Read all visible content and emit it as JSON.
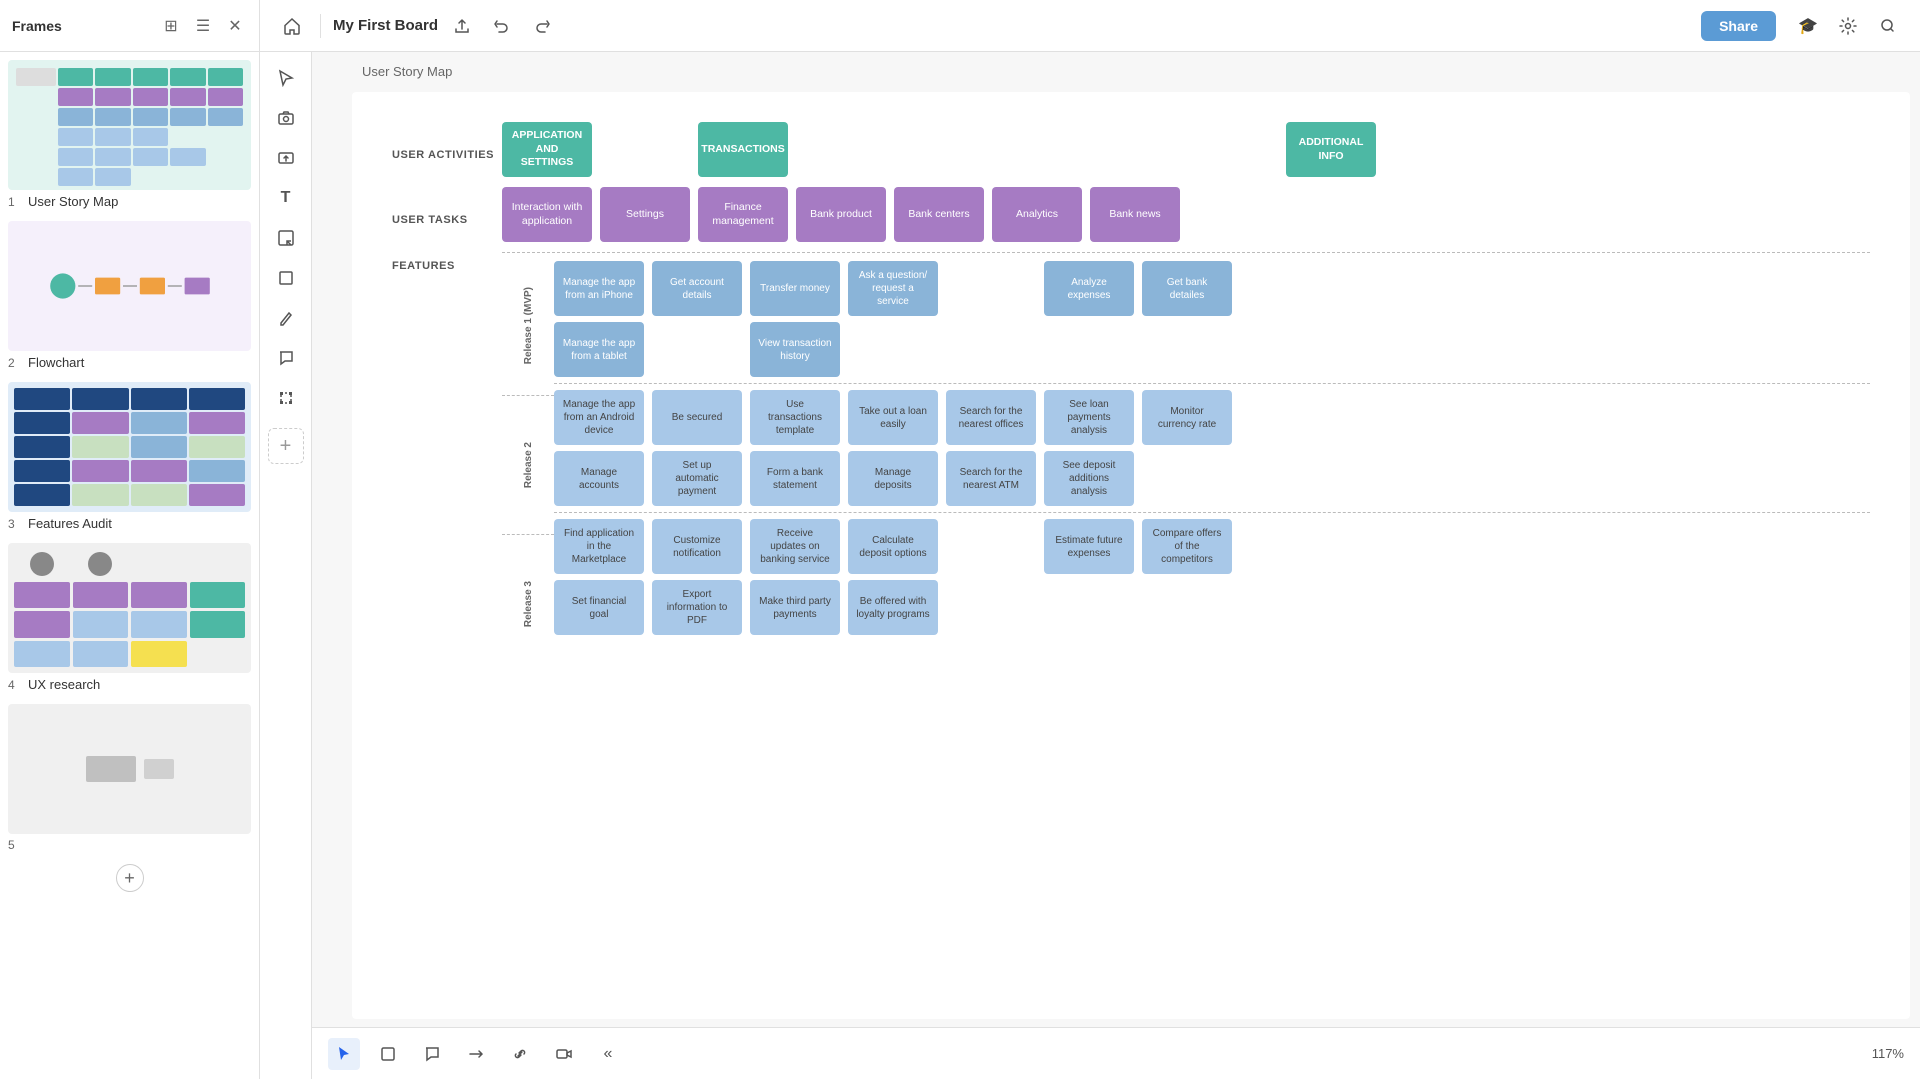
{
  "app": {
    "title": "Frames",
    "board_name": "My First Board"
  },
  "frames_panel": {
    "title": "Frames",
    "frames": [
      {
        "number": "1",
        "name": "User Story Map",
        "thumb_type": "usm"
      },
      {
        "number": "2",
        "name": "Flowchart",
        "thumb_type": "flowchart"
      },
      {
        "number": "3",
        "name": "Features Audit",
        "thumb_type": "features"
      },
      {
        "number": "4",
        "name": "UX research",
        "thumb_type": "ux"
      },
      {
        "number": "5",
        "name": "",
        "thumb_type": "empty"
      }
    ]
  },
  "toolbar": {
    "share_label": "Share",
    "breadcrumb": "User Story Map"
  },
  "story_map": {
    "row_labels": {
      "activities": "USER ACTIVITIES",
      "tasks": "USER TASKS",
      "features": "FEATURES"
    },
    "activities": [
      {
        "text": "APPLICATION AND SETTINGS",
        "col": 0
      },
      {
        "text": "TRANSACTIONS",
        "col": 1
      },
      {
        "text": "ADDITIONAL INFO",
        "col": 4
      }
    ],
    "tasks": [
      {
        "text": "Interaction with application"
      },
      {
        "text": "Settings"
      },
      {
        "text": "Finance management"
      },
      {
        "text": "Bank product"
      },
      {
        "text": "Bank centers"
      },
      {
        "text": "Analytics"
      },
      {
        "text": "Bank news"
      }
    ],
    "release1_label": "Release 1 (MVP)",
    "release2_label": "Release 2",
    "release3_label": "Release 3",
    "release1_rows": [
      [
        {
          "text": "Manage the app from an iPhone"
        },
        {
          "text": "Get account details"
        },
        {
          "text": "Transfer money"
        },
        {
          "text": "Ask a question/ request a service"
        },
        {
          "text": ""
        },
        {
          "text": "Analyze expenses"
        },
        {
          "text": "Get bank detailes"
        }
      ],
      [
        {
          "text": "Manage the app from a tablet"
        },
        {
          "text": ""
        },
        {
          "text": "View transaction history"
        },
        {
          "text": ""
        },
        {
          "text": ""
        },
        {
          "text": ""
        },
        {
          "text": ""
        }
      ]
    ],
    "release2_rows": [
      [
        {
          "text": "Manage the app from an Android device"
        },
        {
          "text": "Be secured"
        },
        {
          "text": "Use transactions template"
        },
        {
          "text": "Take out a loan easily"
        },
        {
          "text": "Search for the nearest offices"
        },
        {
          "text": "See loan payments analysis"
        },
        {
          "text": "Monitor currency rate"
        }
      ],
      [
        {
          "text": "Manage accounts"
        },
        {
          "text": "Set up automatic payment"
        },
        {
          "text": "Form a bank statement"
        },
        {
          "text": "Manage deposits"
        },
        {
          "text": "Search for the nearest ATM"
        },
        {
          "text": "See deposit additions analysis"
        },
        {
          "text": ""
        }
      ]
    ],
    "release3_rows": [
      [
        {
          "text": "Find application in the Marketplace"
        },
        {
          "text": "Customize notification"
        },
        {
          "text": "Receive updates on banking service"
        },
        {
          "text": "Calculate deposit options"
        },
        {
          "text": ""
        },
        {
          "text": "Estimate future expenses"
        },
        {
          "text": "Compare offers of the competitors"
        }
      ],
      [
        {
          "text": "Set financial goal"
        },
        {
          "text": "Export information to PDF"
        },
        {
          "text": "Make third party payments"
        },
        {
          "text": "Be offered with loyalty programs"
        },
        {
          "text": ""
        },
        {
          "text": ""
        },
        {
          "text": ""
        }
      ]
    ]
  },
  "bottom_toolbar": {
    "zoom": "117%"
  }
}
